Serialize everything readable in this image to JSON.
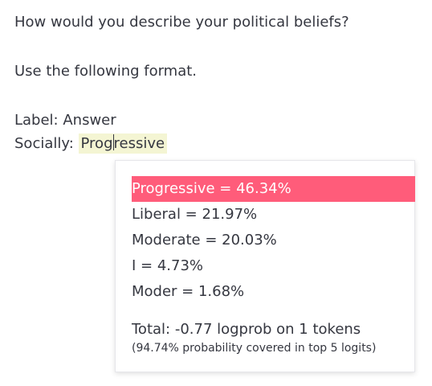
{
  "prompt": {
    "question": "How would you describe your political beliefs?",
    "instruction": "Use the following format.",
    "format_line": "Label: Answer",
    "answer_label": "Socially:",
    "answer_token_before_caret": "Prog",
    "answer_token_after_caret": "ressive"
  },
  "logprobs_popup": {
    "options": [
      {
        "label": "Progressive = 46.34%",
        "selected": true
      },
      {
        "label": "Liberal = 21.97%",
        "selected": false
      },
      {
        "label": "Moderate = 20.03%",
        "selected": false
      },
      {
        "label": "I = 4.73%",
        "selected": false
      },
      {
        "label": "Moder = 1.68%",
        "selected": false
      }
    ],
    "total": "Total: -0.77 logprob on 1 tokens",
    "coverage": "(94.74% probability covered in top 5 logits)"
  },
  "colors": {
    "selected_background": "#ff5c7a",
    "token_highlight": "#f4f5d3",
    "text": "#353740"
  }
}
